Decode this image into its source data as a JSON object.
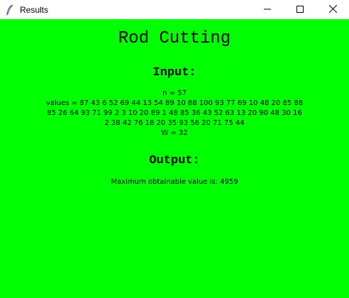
{
  "window": {
    "title": "Results",
    "controls": {
      "minimize_icon": "minimize-icon",
      "maximize_icon": "maximize-icon",
      "close_icon": "close-icon"
    },
    "background": "#00ff00"
  },
  "main": {
    "title": "Rod Cutting",
    "input": {
      "heading": "Input:",
      "n_line": "n = 57",
      "values_lines": [
        "values = 87 43 6 52 69 44 13 54 89 10 88 100 93 77 69 10 48 20 85 88",
        "85 26 64 93 71 99 2 3 10 20 89 1 48 85 36 43 52 63 13 20 90 48 30 16",
        "2 38 42 76 18 20 35 93 56 20 71 75 44"
      ],
      "w_line": "W = 32"
    },
    "output": {
      "heading": "Output:",
      "result_line": "Maximum obtainable value is: 4959"
    }
  }
}
